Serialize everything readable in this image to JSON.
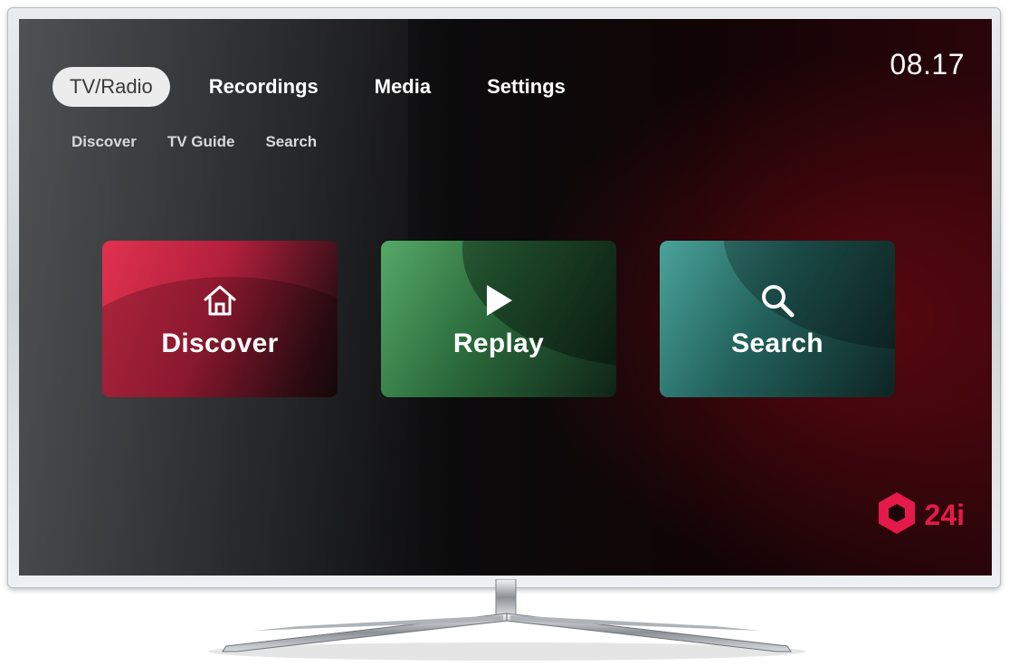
{
  "clock": "08.17",
  "main_nav": [
    {
      "label": "TV/Radio",
      "active": true
    },
    {
      "label": "Recordings",
      "active": false
    },
    {
      "label": "Media",
      "active": false
    },
    {
      "label": "Settings",
      "active": false
    }
  ],
  "sub_nav": [
    {
      "label": "Discover"
    },
    {
      "label": "TV Guide"
    },
    {
      "label": "Search"
    }
  ],
  "tiles": [
    {
      "label": "Discover",
      "icon": "home-icon"
    },
    {
      "label": "Replay",
      "icon": "play-icon"
    },
    {
      "label": "Search",
      "icon": "search-icon"
    }
  ],
  "brand": {
    "text": "24i",
    "color": "#e6194b",
    "icon": "hexagon-logo-icon"
  },
  "colors": {
    "discover_tile": "#d42a4a",
    "replay_tile": "#4e9e62",
    "search_tile": "#3f9891",
    "active_nav_pill": "#ececec"
  }
}
